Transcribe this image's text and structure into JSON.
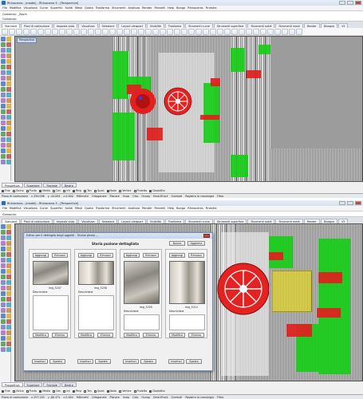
{
  "window_top": {
    "title": "Rhinoceros - (model) - Rhinoceros 5 - [Perspective]",
    "menu": [
      "File",
      "Modifica",
      "Visualizza",
      "Curve",
      "Superfici",
      "Solidi",
      "Mesh",
      "Quota",
      "Trasforma",
      "Strumenti",
      "Analizza",
      "Render",
      "Pannelli",
      "Help",
      "Bongo",
      "Rhinoceros",
      "Finestra"
    ],
    "command_lines": [
      "Comando: _Zoom",
      "Comando:"
    ],
    "tabs": [
      "Standard",
      "Piani di costruzione",
      "Imposta vista",
      "Visualizza",
      "Selezione",
      "Layout viewport",
      "Visibilità",
      "Trasforma",
      "Strumenti curve",
      "Strumenti superficie",
      "Strumenti solidi",
      "Strumenti mesh",
      "Render",
      "Disegno",
      "V5"
    ],
    "viewport_label": "Perspective",
    "viewport_tabs": [
      "Prospettiva",
      "Superiore",
      "Frontale",
      "Destra"
    ],
    "osnap": [
      "Fine",
      "Vicino",
      "Punto",
      "Medio",
      "Cen",
      "Int",
      "Perp",
      "Tan",
      "Quad",
      "Nodo",
      "Vertice",
      "Proietta",
      "Disabilita"
    ],
    "status": [
      "Piano di costruzione",
      "x 250.096",
      "y -44.094",
      "z 0.000",
      "Millimetri",
      "Ortogonale",
      "Planare",
      "Snap",
      "Orto",
      "Osnap",
      "SmartTrack",
      "Gumball",
      "Registra la cronologia",
      "Filtro"
    ]
  },
  "window_bottom": {
    "title": "Rhinoceros - (model) - Rhinoceros 5 - [Perspective]",
    "command_label": "Comando:",
    "dialog": {
      "title": "Editor per il dettaglio degli oggetti - Tavola photo ...",
      "heading": "Storia pozione dettagliata",
      "top_buttons": [
        "Nuovo",
        "Aggiorna"
      ],
      "panels": [
        {
          "buttons": [
            "Aggiungi",
            "Rimuovi"
          ],
          "caption": "Img_5207",
          "subcaption": "Descrizione",
          "bottom_buttons": [
            "Modifica",
            "Elimina"
          ]
        },
        {
          "buttons": [
            "Aggiungi",
            "Rimuovi"
          ],
          "caption": "Img_5208",
          "subcaption": "Descrizione",
          "bottom_buttons": [
            "Modifica",
            "Elimina"
          ]
        },
        {
          "buttons": [
            "Aggiungi",
            "Rimuovi"
          ],
          "caption": "Img_5209",
          "subcaption": "Descrizione",
          "bottom_buttons": [
            "Modifica",
            "Elimina"
          ]
        },
        {
          "buttons": [
            "Aggiungi",
            "Rimuovi"
          ],
          "caption": "Img_5210",
          "subcaption": "Descrizione",
          "bottom_buttons": [
            "Modifica",
            "Elimina"
          ]
        }
      ],
      "footer_buttons": [
        "Inserisci",
        "Sposta",
        "Inserisci",
        "Sposta",
        "Inserisci",
        "Sposta",
        "Inserisci",
        "Sposta"
      ]
    },
    "viewport_tabs": [
      "Prospettiva",
      "Superiore",
      "Frontale",
      "Destra"
    ],
    "osnap": [
      "Fine",
      "Vicino",
      "Punto",
      "Medio",
      "Cen",
      "Int",
      "Perp",
      "Tan",
      "Quad",
      "Nodo",
      "Vertice",
      "Proietta",
      "Disabilita"
    ],
    "status": [
      "Piano di costruzione",
      "x 257.203",
      "y -60.471",
      "z 0.000",
      "Millimetri",
      "Ortogonale",
      "Planare",
      "Snap",
      "Orto",
      "Osnap",
      "SmartTrack",
      "Gumball",
      "Registra la cronologia",
      "Filtro"
    ]
  },
  "colors": {
    "highlight_green": "#18cd18",
    "highlight_red": "#e11e1e",
    "highlight_yellow": "#f2e200",
    "viewport_bg": "#9c9c9c"
  }
}
